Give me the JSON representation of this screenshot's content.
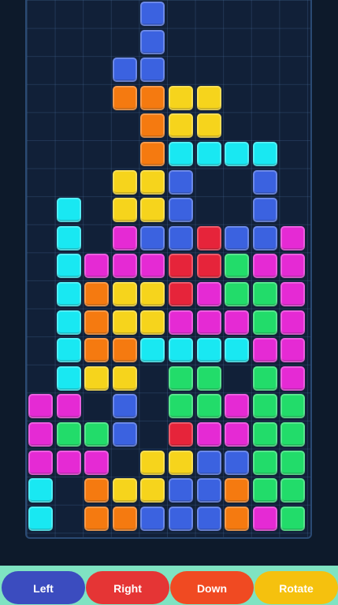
{
  "controls": {
    "left_label": "Left",
    "right_label": "Right",
    "down_label": "Down",
    "rotate_label": "Rotate"
  },
  "colors": {
    "B": "#3b62e0",
    "O": "#f57a10",
    "Y": "#f6d41c",
    "C": "#19e8f2",
    "M": "#e52ad4",
    "R": "#e6243a",
    "G": "#22dc6a"
  },
  "board": {
    "columns": 10,
    "rows": [
      "....B.....",
      "....B.....",
      "...BB.....",
      "...OOYY...",
      "....OYY...",
      "....OCCCC.",
      "...YYB..B.",
      ".C.YYB..B.",
      ".C.MBBRBBM",
      ".CMMMRRGMM",
      ".COYYRMGGM",
      ".COYYMMMGM",
      ".COOCCCCMM",
      ".CYY.GG.GM",
      "MM.B.GGMGG",
      "MGGB.RMMGG",
      "MMM.YYBBGG",
      "C.OYYBBOGG",
      "C.OOBBBOMG"
    ]
  }
}
